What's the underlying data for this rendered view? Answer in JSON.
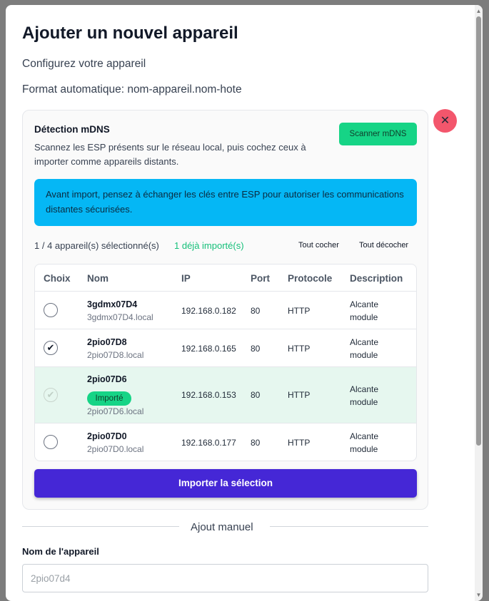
{
  "modal": {
    "title": "Ajouter un nouvel appareil",
    "subtitle": "Configurez votre appareil",
    "format_hint": "Format automatique: nom-appareil.nom-hote",
    "close_label": "✕"
  },
  "mdns": {
    "title": "Détection mDNS",
    "description": "Scannez les ESP présents sur le réseau local, puis cochez ceux à importer comme appareils distants.",
    "scan_button": "Scanner mDNS",
    "info_text": "Avant import, pensez à échanger les clés entre ESP pour autoriser les communications distantes sécurisées.",
    "selection_count": "1 / 4 appareil(s) sélectionné(s)",
    "already_imported": "1 déjà importé(s)",
    "select_all": "Tout cocher",
    "deselect_all": "Tout décocher",
    "columns": [
      "Choix",
      "Nom",
      "IP",
      "Port",
      "Protocole",
      "Description"
    ],
    "devices": [
      {
        "name": "3gdmx07D4",
        "host": "3gdmx07D4.local",
        "ip": "192.168.0.182",
        "port": "80",
        "protocol": "HTTP",
        "description": "Alcante module",
        "checked": false,
        "imported": false,
        "check_mark": ""
      },
      {
        "name": "2pio07D8",
        "host": "2pio07D8.local",
        "ip": "192.168.0.165",
        "port": "80",
        "protocol": "HTTP",
        "description": "Alcante module",
        "checked": true,
        "imported": false,
        "check_mark": "✔"
      },
      {
        "name": "2pio07D6",
        "host": "2pio07D6.local",
        "ip": "192.168.0.153",
        "port": "80",
        "protocol": "HTTP",
        "description": "Alcante module",
        "checked": true,
        "imported": true,
        "badge": "Importé",
        "check_mark": "✔"
      },
      {
        "name": "2pio07D0",
        "host": "2pio07D0.local",
        "ip": "192.168.0.177",
        "port": "80",
        "protocol": "HTTP",
        "description": "Alcante module",
        "checked": false,
        "imported": false,
        "check_mark": ""
      }
    ],
    "import_button": "Importer la sélection"
  },
  "manual": {
    "divider_label": "Ajout manuel",
    "name_label": "Nom de l'appareil",
    "name_placeholder": "2pio07d4",
    "name_value": ""
  },
  "colors": {
    "accent": "#4527d6",
    "success": "#16d486",
    "info": "#05b7f5",
    "danger": "#f3566c"
  }
}
